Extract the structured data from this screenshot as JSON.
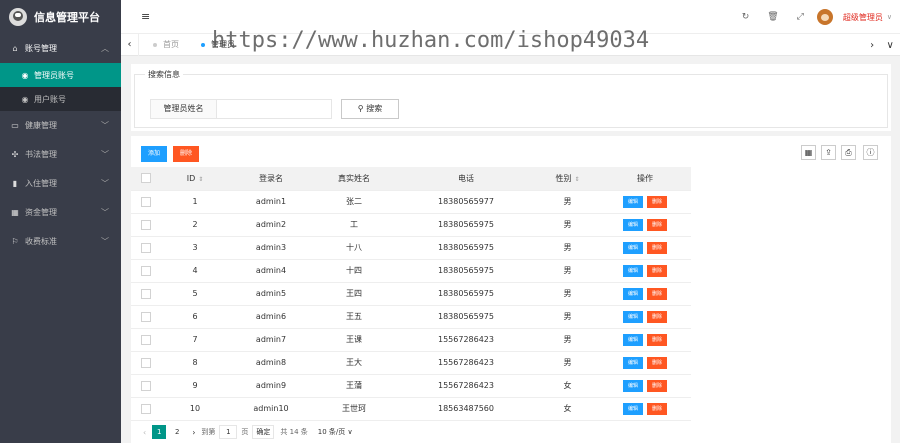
{
  "app": {
    "title": "信息管理平台"
  },
  "sidebar": {
    "items": [
      {
        "label": "账号管理",
        "icon": "home-icon",
        "open": true,
        "children": [
          {
            "label": "管理员账号",
            "icon": "gauge-icon",
            "active": true
          },
          {
            "label": "用户账号",
            "icon": "gauge-icon",
            "active": false
          }
        ]
      },
      {
        "label": "健康管理",
        "icon": "monitor-icon"
      },
      {
        "label": "书法管理",
        "icon": "app-icon"
      },
      {
        "label": "入住管理",
        "icon": "file-icon"
      },
      {
        "label": "资金管理",
        "icon": "grid-icon"
      },
      {
        "label": "收费标准",
        "icon": "flag-icon"
      }
    ]
  },
  "header": {
    "menu_glyph": "≡",
    "username": "超级管理员"
  },
  "tabs": [
    {
      "label": "首页",
      "active": false
    },
    {
      "label": "管理员",
      "active": true
    }
  ],
  "watermark": "https://www.huzhan.com/ishop49034",
  "search": {
    "legend": "搜索信息",
    "field_label": "管理员姓名",
    "input_value": "",
    "button_label": "搜索"
  },
  "toolbar": {
    "add_label": "添加",
    "delete_label": "删除"
  },
  "table": {
    "columns": [
      "ID",
      "登录名",
      "真实姓名",
      "电话",
      "性别",
      "操作"
    ],
    "edit_label": "编辑",
    "delete_label": "删除",
    "rows": [
      {
        "id": "1",
        "login": "admin1",
        "name": "张二",
        "phone": "18380565977",
        "gender": "男"
      },
      {
        "id": "2",
        "login": "admin2",
        "name": "工",
        "phone": "18380565975",
        "gender": "男"
      },
      {
        "id": "3",
        "login": "admin3",
        "name": "十八",
        "phone": "18380565975",
        "gender": "男"
      },
      {
        "id": "4",
        "login": "admin4",
        "name": "十四",
        "phone": "18380565975",
        "gender": "男"
      },
      {
        "id": "5",
        "login": "admin5",
        "name": "王四",
        "phone": "18380565975",
        "gender": "男"
      },
      {
        "id": "6",
        "login": "admin6",
        "name": "王五",
        "phone": "18380565975",
        "gender": "男"
      },
      {
        "id": "7",
        "login": "admin7",
        "name": "王课",
        "phone": "15567286423",
        "gender": "男"
      },
      {
        "id": "8",
        "login": "admin8",
        "name": "王大",
        "phone": "15567286423",
        "gender": "男"
      },
      {
        "id": "9",
        "login": "admin9",
        "name": "王蒲",
        "phone": "15567286423",
        "gender": "女"
      },
      {
        "id": "10",
        "login": "admin10",
        "name": "王世珂",
        "phone": "18563487560",
        "gender": "女"
      }
    ]
  },
  "pager": {
    "current": "1",
    "next_page": "2",
    "goto_label": "到第",
    "goto_value": "1",
    "page_unit": "页",
    "confirm_label": "确定",
    "total_label": "共 14 条",
    "page_size": "10 条/页"
  }
}
